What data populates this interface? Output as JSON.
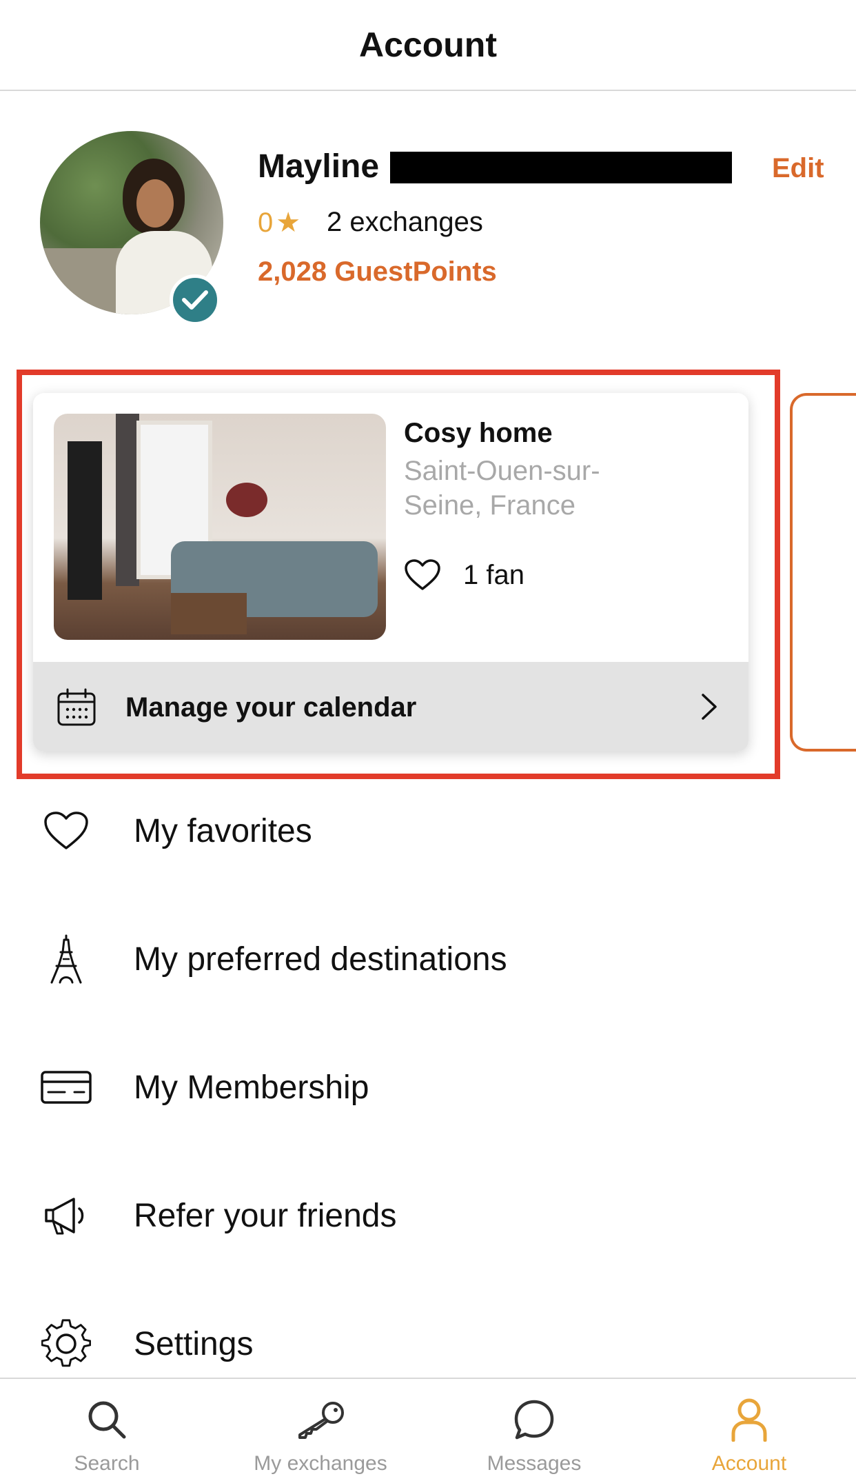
{
  "header": {
    "title": "Account"
  },
  "profile": {
    "name": "Mayline",
    "edit_label": "Edit",
    "rating_value": "0",
    "rating_star": "★",
    "exchanges": "2 exchanges",
    "guestpoints": "2,028 GuestPoints",
    "verified": true
  },
  "home_card": {
    "title": "Cosy home",
    "location": "Saint-Ouen-sur-Seine, France",
    "fans": "1 fan",
    "calendar_label": "Manage your calendar"
  },
  "menu": {
    "items": [
      {
        "label": "My favorites",
        "icon": "heart-icon"
      },
      {
        "label": "My preferred destinations",
        "icon": "eiffel-tower-icon"
      },
      {
        "label": "My Membership",
        "icon": "credit-card-icon"
      },
      {
        "label": "Refer your friends",
        "icon": "megaphone-icon"
      },
      {
        "label": "Settings",
        "icon": "gear-icon"
      }
    ]
  },
  "tabbar": {
    "tabs": [
      {
        "label": "Search",
        "icon": "search-icon",
        "active": false
      },
      {
        "label": "My exchanges",
        "icon": "key-icon",
        "active": false
      },
      {
        "label": "Messages",
        "icon": "chat-bubble-icon",
        "active": false
      },
      {
        "label": "Account",
        "icon": "person-icon",
        "active": true
      }
    ]
  },
  "colors": {
    "accent_orange": "#d9692b",
    "accent_yellow": "#e8a53a",
    "verified_teal": "#2f7f87",
    "highlight_red": "#e23b2a"
  }
}
